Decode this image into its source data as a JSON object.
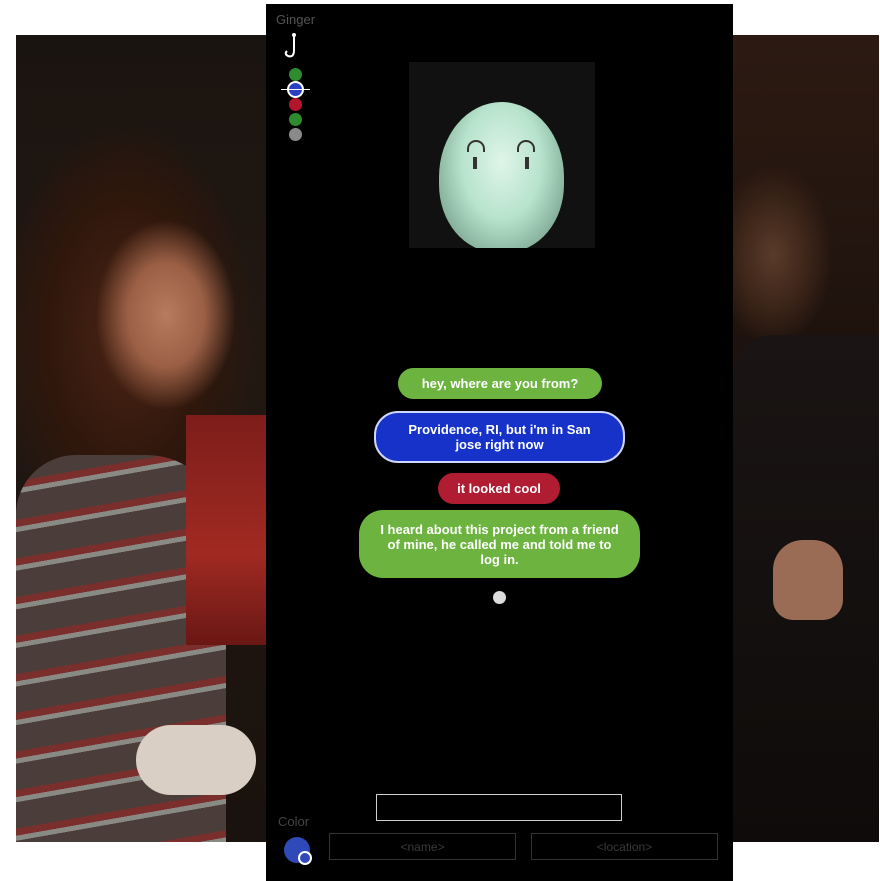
{
  "app": {
    "username": "Ginger"
  },
  "palette": {
    "dots": [
      "#2e8b2e",
      "#2a3fc4",
      "#b3162a",
      "#2e8b2e",
      "#8a8a8a"
    ],
    "selected_index": 1
  },
  "messages": [
    {
      "text": "hey, where are you from?",
      "color": "#6db33f"
    },
    {
      "text": "Providence, RI, but i'm in San jose right now",
      "color": "#1632c8"
    },
    {
      "text": "it looked cool",
      "color": "#b01d33"
    },
    {
      "text": "I heard about this project from a friend of mine, he called me and told me to log in.",
      "color": "#6db33f"
    }
  ],
  "input": {
    "message_value": "",
    "name_placeholder": "<name>",
    "location_placeholder": "<location>"
  },
  "color_picker": {
    "label": "Color",
    "current": "#2f4ab8"
  },
  "icons": {
    "hook": "hook-icon",
    "avatar_video": "video-feed"
  }
}
